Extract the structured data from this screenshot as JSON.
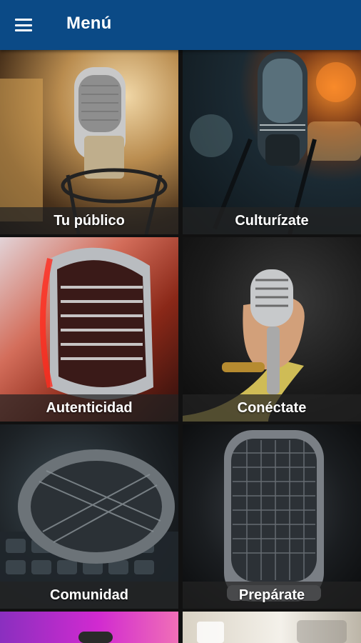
{
  "appbar": {
    "title": "Menú",
    "menu_icon": "hamburger-menu-icon",
    "color": "#0b4a86"
  },
  "tiles": [
    {
      "label": "Tu público",
      "image": "studio-condenser-microphone"
    },
    {
      "label": "Culturízate",
      "image": "vintage-microphone-bokeh"
    },
    {
      "label": "Autenticidad",
      "image": "chrome-vintage-microphone-red-light"
    },
    {
      "label": "Conéctate",
      "image": "hand-holding-vintage-microphone"
    },
    {
      "label": "Comunidad",
      "image": "microphone-on-keyboard"
    },
    {
      "label": "Prepárate",
      "image": "close-up-microphone-mesh"
    },
    {
      "label": "",
      "image": "microphone-purple-background"
    },
    {
      "label": "",
      "image": "bright-room-photo"
    }
  ]
}
